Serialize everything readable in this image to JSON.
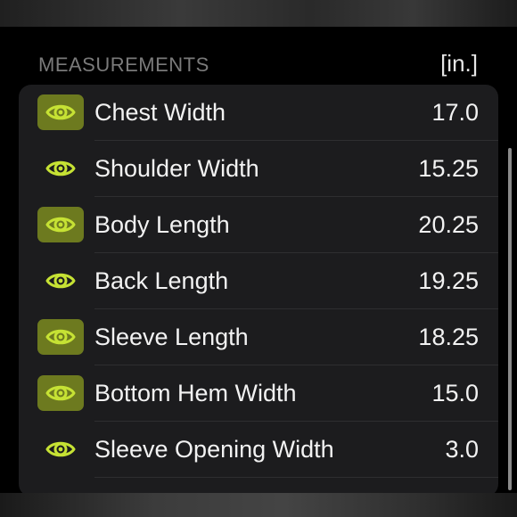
{
  "header": {
    "section_title": "MEASUREMENTS",
    "unit": "[in.]"
  },
  "colors": {
    "accent": "#c6e234",
    "accent_box": "#6d7a1f",
    "card_bg": "#1c1c1e",
    "text": "#f2f2f2"
  },
  "measurements": [
    {
      "label": "Chest Width",
      "value": "17.0",
      "icon": "eye-icon",
      "icon_highlighted": true
    },
    {
      "label": "Shoulder Width",
      "value": "15.25",
      "icon": "eye-icon",
      "icon_highlighted": false
    },
    {
      "label": "Body Length",
      "value": "20.25",
      "icon": "eye-icon",
      "icon_highlighted": true
    },
    {
      "label": "Back Length",
      "value": "19.25",
      "icon": "eye-icon",
      "icon_highlighted": false
    },
    {
      "label": "Sleeve Length",
      "value": "18.25",
      "icon": "eye-icon",
      "icon_highlighted": true
    },
    {
      "label": "Bottom Hem Width",
      "value": "15.0",
      "icon": "eye-icon",
      "icon_highlighted": true
    },
    {
      "label": "Sleeve Opening Width",
      "value": "3.0",
      "icon": "eye-icon",
      "icon_highlighted": false
    }
  ]
}
